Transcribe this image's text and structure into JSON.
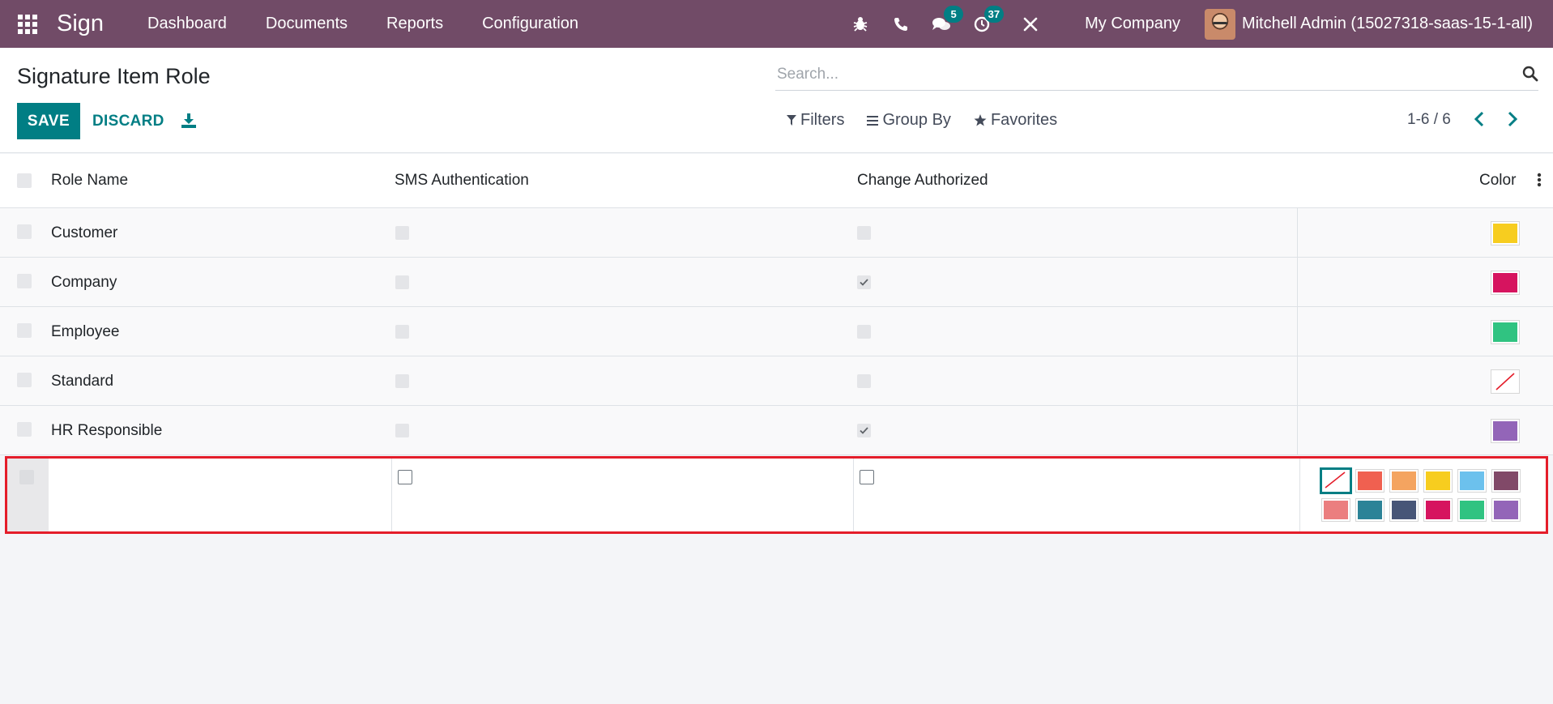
{
  "navbar": {
    "app_name": "Sign",
    "menu": [
      "Dashboard",
      "Documents",
      "Reports",
      "Configuration"
    ],
    "messages_count": "5",
    "activities_count": "37",
    "company": "My Company",
    "user": "Mitchell Admin (15027318-saas-15-1-all)",
    "bg_color": "#714b67"
  },
  "control": {
    "title": "Signature Item Role",
    "save_label": "SAVE",
    "discard_label": "DISCARD",
    "search_placeholder": "Search...",
    "filters_label": "Filters",
    "groupby_label": "Group By",
    "favorites_label": "Favorites",
    "pager": "1-6 / 6",
    "accent_color": "#017e84"
  },
  "table": {
    "headers": {
      "role_name": "Role Name",
      "sms_auth": "SMS Authentication",
      "change_auth": "Change Authorized",
      "color": "Color"
    },
    "rows": [
      {
        "name": "Customer",
        "sms": false,
        "change": false,
        "color": "#f7cd1f"
      },
      {
        "name": "Company",
        "sms": false,
        "change": true,
        "color": "#d6145f"
      },
      {
        "name": "Employee",
        "sms": false,
        "change": false,
        "color": "#30c381"
      },
      {
        "name": "Standard",
        "sms": false,
        "change": false,
        "color": "none"
      },
      {
        "name": "HR Responsible",
        "sms": false,
        "change": true,
        "color": "#9365b8"
      }
    ],
    "palette": [
      "none",
      "#f06050",
      "#f4a460",
      "#f7cd1f",
      "#6cc1ed",
      "#814968",
      "#eb7e7f",
      "#2c8397",
      "#475577",
      "#d6145f",
      "#30c381",
      "#9365b8"
    ]
  }
}
